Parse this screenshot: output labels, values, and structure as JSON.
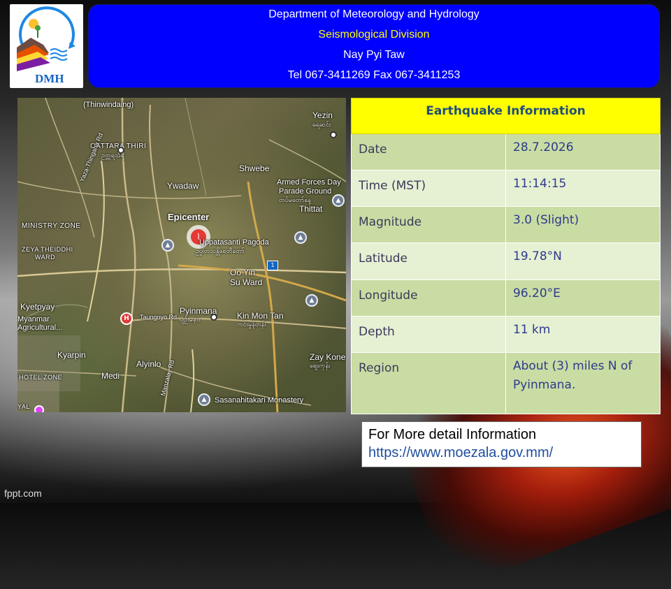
{
  "header": {
    "line1": "Department of Meteorology and Hydrology",
    "line2": "Seismological Division",
    "line3": "Nay Pyi Taw",
    "line4": "Tel 067-3411269 Fax 067-3411253"
  },
  "logo": {
    "text": "DMH"
  },
  "map": {
    "epicenter_label": "Epicenter",
    "labels": {
      "thinwindaing": "(Thinwindaing)",
      "oattara": "OATTARA THIRI",
      "oattara_local": "ဥတ္တရသီရိ",
      "yezin": "Yezin",
      "yezin_local": "ရေဆင်း",
      "shwebe": "Shwebe",
      "ywadaw": "Ywadaw",
      "parade1": "Armed Forces Day",
      "parade2": "Parade Ground",
      "parade3": "တပ်မတော်နေ့",
      "thittat": "Thittat",
      "ministry": "MINISTRY ZONE",
      "zeya1": "ZEYA THEIDDHI",
      "zeya2": "WARD",
      "pagoda": "Uppatasanti Pagoda",
      "pagoda_local": "ဥပ္ပါတသန္တိစေတီတော်",
      "ooyin1": "Oo Yin",
      "ooyin2": "Su Ward",
      "kyetpyay": "Kyetpyay",
      "myanmar1": "Myanmar",
      "myanmar2": "Agricultural...",
      "pyinmana": "Pyinmana",
      "pyinmana_local": "ပျဉ်းမနား",
      "kinmontan": "Kin Mon Tan",
      "kinmontan_local": "ကင်းမွန်တန်း",
      "taungnyo": "Taungnyo Rd",
      "kyarpin": "Kyarpin",
      "alyinlo": "Alyinlo",
      "medi": "Medi",
      "hotel": "HOTEL ZONE",
      "zaykone": "Zay Kone",
      "zaykone_local": "ဈေးကုန်း",
      "sasana": "Sasanahitakari Monastery",
      "yazathingaha": "Yaza-Thingaha Rd",
      "manzalay": "Manzalay Rd",
      "yal": "YAL",
      "route": "1"
    }
  },
  "info_table": {
    "title": "Earthquake Information",
    "rows": [
      {
        "label": "Date",
        "value": "28.7.2026"
      },
      {
        "label": "Time (MST)",
        "value": "11:14:15"
      },
      {
        "label": "Magnitude",
        "value": "3.0 (Slight)"
      },
      {
        "label": "Latitude",
        "value": "19.78°N"
      },
      {
        "label": "Longitude",
        "value": "96.20°E"
      },
      {
        "label": "Depth",
        "value": "11 km"
      },
      {
        "label": "Region",
        "value": "About (3)  miles N of Pyinmana."
      }
    ]
  },
  "detail": {
    "line1": "For More detail Information",
    "link": "https://www.moezala.gov.mm/"
  },
  "watermark": "fppt.com"
}
